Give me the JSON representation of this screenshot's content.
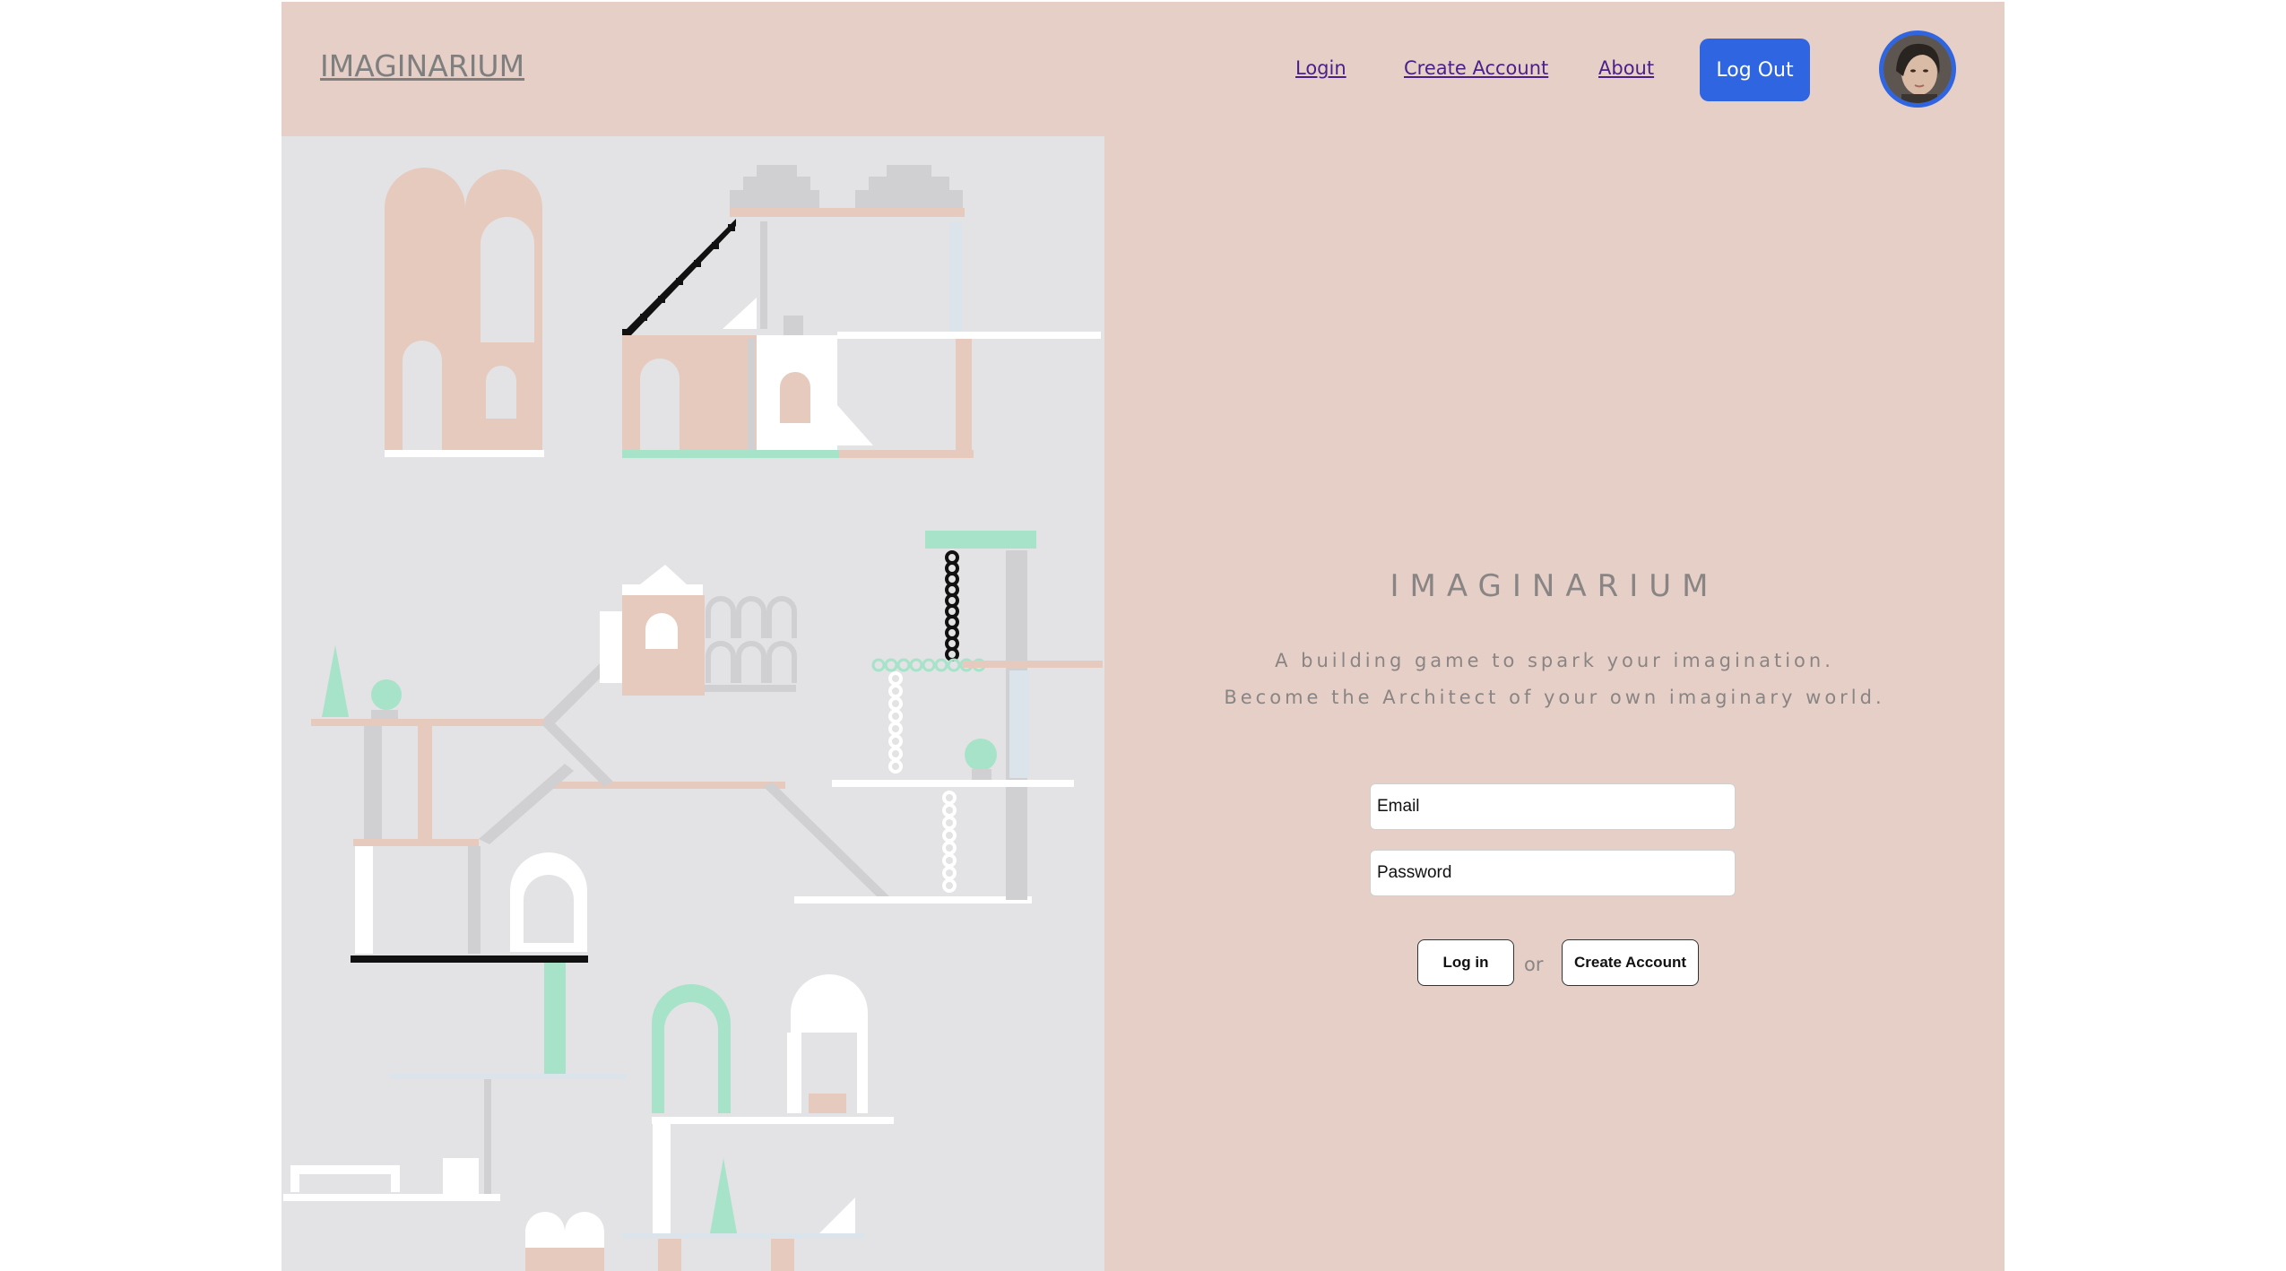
{
  "navbar": {
    "brand": "IMAGINARIUM",
    "links": [
      "Login",
      "Create Account",
      "About"
    ],
    "logout_label": "Log Out"
  },
  "hero": {
    "title": "IMAGINARIUM",
    "tagline_1": "A building game to spark your imagination.",
    "tagline_2": "Become the Architect of your own imaginary world."
  },
  "form": {
    "email_placeholder": "Email",
    "password_placeholder": "Password",
    "login_label": "Log in",
    "or_label": "or",
    "create_label": "Create Account"
  },
  "colors": {
    "page_bg": "#e6cfc6",
    "art_bg": "#e3e2e4",
    "accent": "#2f65e0",
    "salmon": "#e6cabd",
    "mint": "#a6e3c9",
    "gray_block": "#d0cfd1"
  }
}
